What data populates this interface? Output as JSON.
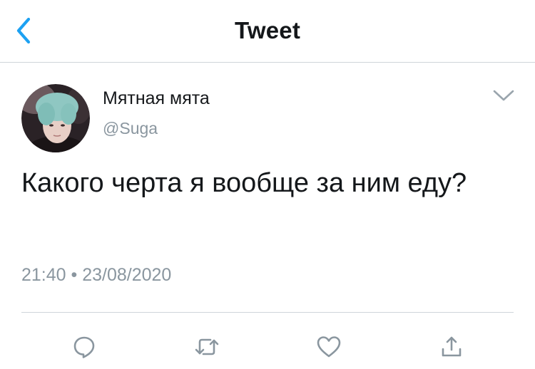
{
  "header": {
    "title": "Tweet",
    "back_icon": "chevron-left-icon",
    "accent_color": "#1da1f2"
  },
  "tweet": {
    "author_name": "Мятная мята",
    "author_handle": "@Suga",
    "text": "Какого черта я вообще за ним еду?",
    "timestamp": "21:40 • 23/08/2020"
  },
  "actions": [
    {
      "icon": "reply-icon"
    },
    {
      "icon": "retweet-icon"
    },
    {
      "icon": "like-icon"
    },
    {
      "icon": "share-icon"
    }
  ],
  "colors": {
    "text": "#14171a",
    "secondary_text": "#8a969f",
    "divider": "#cfd5da",
    "icon_gray": "#8a969f"
  }
}
